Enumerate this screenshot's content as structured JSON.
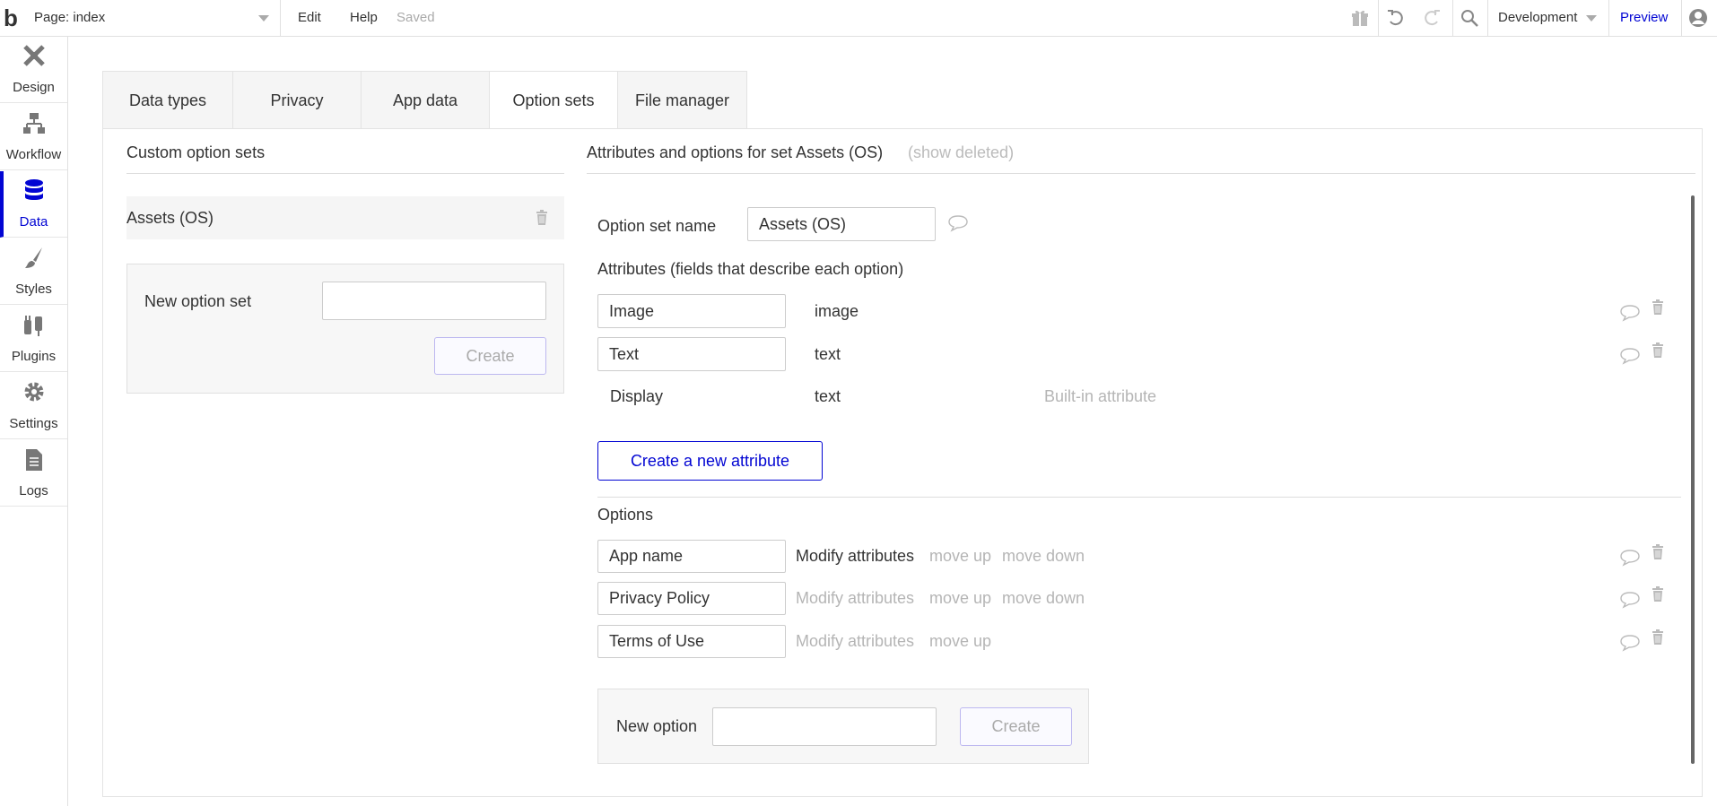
{
  "topbar": {
    "logo": "b",
    "page_label": "Page: index",
    "menu": {
      "edit": "Edit",
      "help": "Help",
      "saved": "Saved"
    },
    "environment": "Development",
    "preview": "Preview",
    "icons": [
      "gift-icon",
      "undo-icon",
      "redo-icon",
      "search-icon",
      "user-icon"
    ]
  },
  "sidebar": {
    "items": [
      {
        "label": "Design",
        "icon": "design-icon"
      },
      {
        "label": "Workflow",
        "icon": "workflow-icon"
      },
      {
        "label": "Data",
        "icon": "database-icon",
        "active": true
      },
      {
        "label": "Styles",
        "icon": "brush-icon"
      },
      {
        "label": "Plugins",
        "icon": "plug-icon"
      },
      {
        "label": "Settings",
        "icon": "gear-icon"
      },
      {
        "label": "Logs",
        "icon": "document-icon"
      }
    ]
  },
  "tabs": [
    {
      "label": "Data types"
    },
    {
      "label": "Privacy"
    },
    {
      "label": "App data"
    },
    {
      "label": "Option sets",
      "active": true
    },
    {
      "label": "File manager"
    }
  ],
  "left_panel": {
    "title": "Custom option sets",
    "sets": [
      {
        "name": "Assets (OS)"
      }
    ],
    "new_set": {
      "label": "New option set",
      "value": "",
      "create_label": "Create"
    }
  },
  "right_panel": {
    "title": "Attributes and options for set Assets (OS)",
    "show_deleted": "(show deleted)",
    "option_set_name_label": "Option set name",
    "option_set_name_value": "Assets (OS)",
    "attributes_title": "Attributes (fields that describe each option)",
    "attributes": [
      {
        "name": "Image",
        "type": "image",
        "editable": true
      },
      {
        "name": "Text",
        "type": "text",
        "editable": true
      },
      {
        "name": "Display",
        "type": "text",
        "note": "Built-in attribute",
        "editable": false
      }
    ],
    "create_attribute_label": "Create a new attribute",
    "options_title": "Options",
    "options": [
      {
        "name": "App name",
        "modify": "Modify attributes",
        "move_up": "move up",
        "move_down": "move down",
        "modify_active": true
      },
      {
        "name": "Privacy Policy",
        "modify": "Modify attributes",
        "move_up": "move up",
        "move_down": "move down",
        "modify_active": false
      },
      {
        "name": "Terms of Use",
        "modify": "Modify attributes",
        "move_up": "move up",
        "modify_active": false
      }
    ],
    "new_option": {
      "label": "New option",
      "value": "",
      "create_label": "Create"
    }
  },
  "colors": {
    "accent": "#0205d3",
    "muted": "#b5b5b5",
    "border": "#e3e3e3"
  }
}
